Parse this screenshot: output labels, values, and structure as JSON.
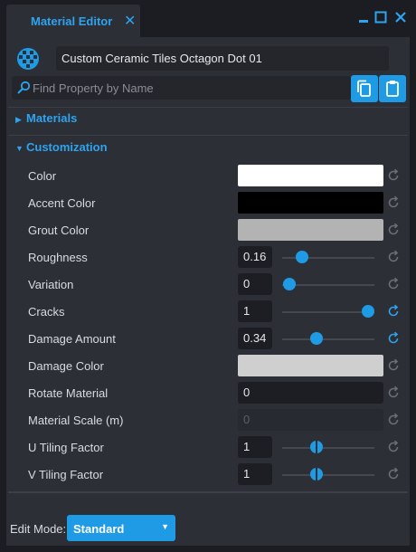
{
  "window": {
    "tab_title": "Material Editor"
  },
  "header": {
    "object_name": "Custom Ceramic Tiles Octagon Dot 01",
    "search_placeholder": "Find Property by Name"
  },
  "sections": {
    "materials": "Materials",
    "customization": "Customization"
  },
  "properties": [
    {
      "label": "Color",
      "kind": "color",
      "color": "#ffffff"
    },
    {
      "label": "Accent Color",
      "kind": "color",
      "color": "#000000"
    },
    {
      "label": "Grout Color",
      "kind": "color",
      "color": "#b3b3b3"
    },
    {
      "label": "Roughness",
      "kind": "slider",
      "value": "0.16",
      "slider_fraction": 0.22,
      "modified": false
    },
    {
      "label": "Variation",
      "kind": "slider",
      "value": "0",
      "slider_fraction": 0.08,
      "modified": false
    },
    {
      "label": "Cracks",
      "kind": "slider",
      "value": "1",
      "slider_fraction": 0.93,
      "modified": true
    },
    {
      "label": "Damage Amount",
      "kind": "slider",
      "value": "0.34",
      "slider_fraction": 0.37,
      "modified": true
    },
    {
      "label": "Damage Color",
      "kind": "color",
      "color": "#cfcfcf"
    },
    {
      "label": "Rotate Material",
      "kind": "number",
      "value": "0"
    },
    {
      "label": "Material Scale (m)",
      "kind": "number-disabled",
      "value": "0"
    },
    {
      "label": "U Tiling Factor",
      "kind": "slider-split",
      "value": "1",
      "slider_fraction": 0.37,
      "modified": false
    },
    {
      "label": "V Tiling Factor",
      "kind": "slider-split",
      "value": "1",
      "slider_fraction": 0.37,
      "modified": false
    }
  ],
  "footer": {
    "edit_mode_label": "Edit Mode:",
    "edit_mode_value": "Standard"
  },
  "colors": {
    "accent": "#1f9be6",
    "panel": "#2c2f36",
    "background": "#1b1d22"
  }
}
